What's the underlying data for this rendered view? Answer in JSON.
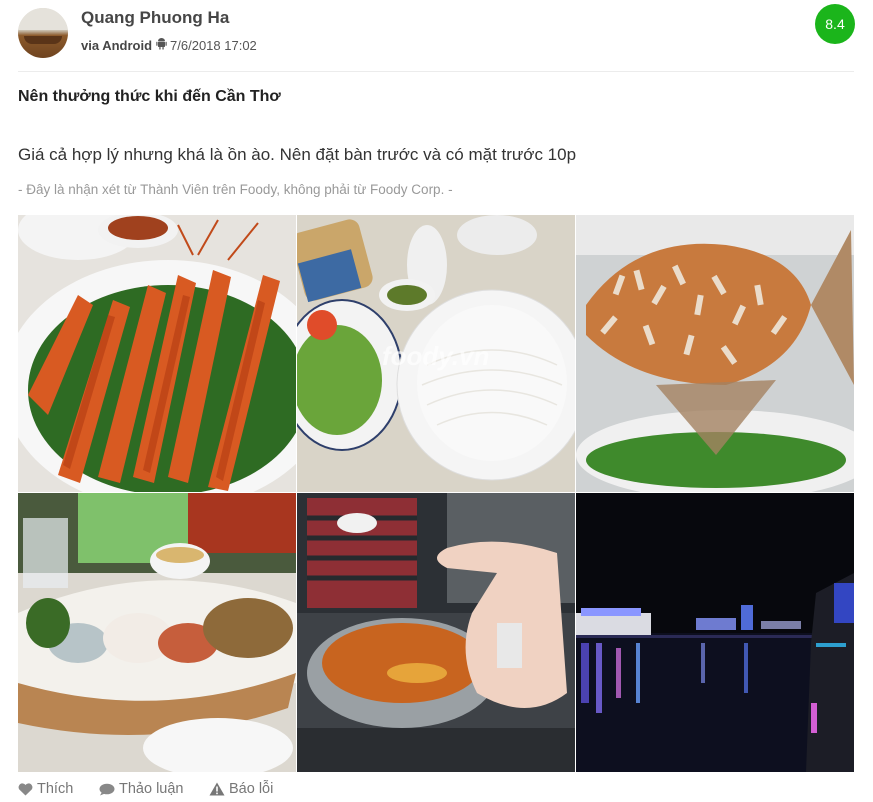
{
  "author": {
    "name": "Quang Phuong Ha",
    "via": "via Android",
    "timestamp": "7/6/2018 17:02"
  },
  "score": "8.4",
  "review": {
    "title": "Nên thưởng thức khi đến Cần Thơ",
    "body": "Giá cả hợp lý nhưng khá là ồn ào. Nên đặt bàn trước và có mặt trước 10p",
    "disclaimer": "- Đây là nhận xét từ Thành Viên trên Foody, không phải từ Foody Corp. -"
  },
  "photos": [
    {
      "name": "photo-grilled-prawns"
    },
    {
      "name": "photo-rice-noodles-salad"
    },
    {
      "name": "photo-fried-fish"
    },
    {
      "name": "photo-hotpot-platter"
    },
    {
      "name": "photo-hotpot-pot"
    },
    {
      "name": "photo-night-river"
    }
  ],
  "watermark": "foody.vn",
  "actions": {
    "like": "Thích",
    "discuss": "Thảo luận",
    "report": "Báo lỗi"
  },
  "colors": {
    "score_badge": "#1bb51b",
    "muted_text": "#999999"
  }
}
